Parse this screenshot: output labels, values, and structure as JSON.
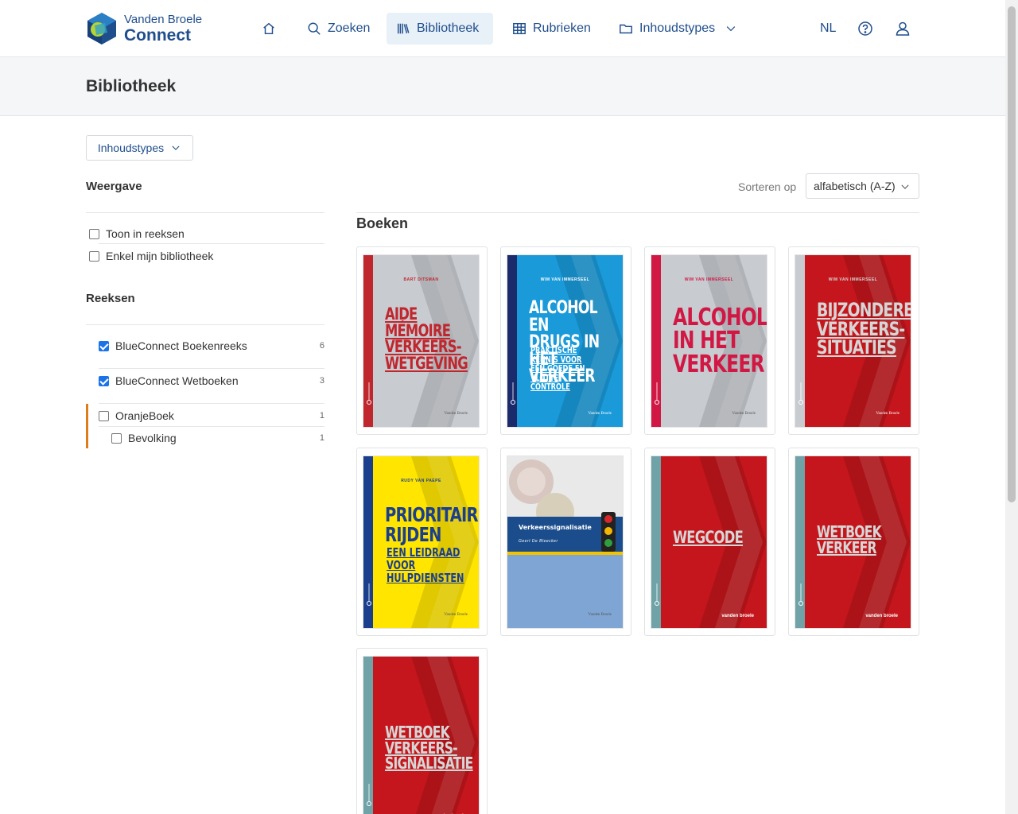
{
  "brand": {
    "line1": "Vanden Broele",
    "line2": "Connect"
  },
  "nav": {
    "items": [
      {
        "label": "Zoeken"
      },
      {
        "label": "Bibliotheek"
      },
      {
        "label": "Rubrieken"
      },
      {
        "label": "Inhoudstypes"
      }
    ],
    "language": "NL"
  },
  "page": {
    "title": "Bibliotheek"
  },
  "filter": {
    "button_label": "Inhoudstypes"
  },
  "sidebar": {
    "weergave": {
      "heading": "Weergave",
      "options": [
        {
          "label": "Toon in reeksen",
          "checked": false
        },
        {
          "label": "Enkel mijn bibliotheek",
          "checked": false
        }
      ]
    },
    "reeksen": {
      "heading": "Reeksen",
      "items": [
        {
          "label": "BlueConnect Boekenreeks",
          "count": "6",
          "checked": true
        },
        {
          "label": "BlueConnect Wetboeken",
          "count": "3",
          "checked": true
        },
        {
          "label": "OranjeBoek",
          "count": "1",
          "checked": false
        },
        {
          "label": "Bevolking",
          "count": "1",
          "checked": false
        }
      ]
    }
  },
  "sort": {
    "label": "Sorteren op",
    "value": "alfabetisch (A-Z)"
  },
  "section": {
    "title": "Boeken"
  },
  "books": [
    {
      "title": "AIDE MÉMOIRE\nVERKEERS-\nWETGEVING",
      "author": "BART DITSMAN",
      "publisher": "Vanden Broele",
      "bg": "#c8cbd0",
      "spine": "#c0262d",
      "text": "#c0262d"
    },
    {
      "title": "ALCOHOL EN\nDRUGS IN\nHET VERKEER",
      "subtitle": "PRAKTISCHE KENNIS VOOR\nEEN GOEDE EN VLOTTE\nCONTROLE",
      "author": "WIM VAN IMMERSEEL",
      "publisher": "Vanden Broele",
      "bg": "#1a9ad9",
      "spine": "#1b2a6b",
      "text": "#ffffff"
    },
    {
      "title": "ALCOHOL\nIN HET\nVERKEER",
      "author": "WIM VAN IMMERSEEL",
      "publisher": "Vanden Broele",
      "bg": "#c8cbd0",
      "spine": "#d11845",
      "text": "#d11845"
    },
    {
      "title": "BIJZONDERE\nVERKEERS-\nSITUATIES",
      "author": "WIM VAN IMMERSEEL",
      "publisher": "Vanden Broele",
      "bg": "#c4161c",
      "spine": "#c8cbd0",
      "text": "#d6d6d6"
    },
    {
      "title": "PRIORITAIR\nRIJDEN",
      "subtitle": "EEN LEIDRAAD\nVOOR\nHULPDIENSTEN",
      "author": "RUDY VAN PAEPE",
      "publisher": "Vanden Broele",
      "bg": "#ffe500",
      "spine": "#1b3f8c",
      "text": "#1b3f8c"
    },
    {
      "title": "Verkeerssignalisatie",
      "author": "Geert De Bleecker",
      "publisher": "Vanden Broele",
      "bg": "#e8e8e8",
      "spine": "#1b4d8c",
      "text": "#ffffff"
    },
    {
      "title": "WEGCODE",
      "publisher": "vanden broele",
      "bg": "#c4161c",
      "spine": "#6fa3a8",
      "text": "#d6d6d6"
    },
    {
      "title": "WETBOEK\nVERKEER",
      "publisher": "vanden broele",
      "bg": "#c4161c",
      "spine": "#6fa3a8",
      "text": "#d6d6d6"
    },
    {
      "title": "WETBOEK\nVERKEERS-\nSIGNALISATIE",
      "publisher": "vanden broele",
      "bg": "#c4161c",
      "spine": "#6fa3a8",
      "text": "#d6d6d6"
    }
  ],
  "icons": {
    "home": "home-icon",
    "search": "search-icon",
    "library": "library-icon",
    "grid": "grid-icon",
    "folder": "folder-icon",
    "chevron": "chevron-down-icon",
    "help": "help-icon",
    "user": "user-icon"
  }
}
